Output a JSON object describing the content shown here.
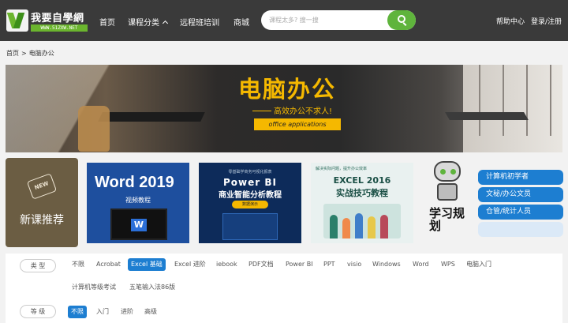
{
  "header": {
    "logo_name": "我要自學網",
    "logo_url": "WWW.51ZXW.NET",
    "nav": [
      "首页",
      "课程分类",
      "远程班培训",
      "商城"
    ],
    "search_placeholder": "课程太多? 搜一搜",
    "help": "帮助中心",
    "login": "登录/注册",
    "colors": {
      "bar": "#3a3a3a",
      "accent": "#5fb43c"
    }
  },
  "breadcrumb": {
    "home": "首页",
    "sep": ">",
    "current": "电脑办公"
  },
  "banner": {
    "title": "电脑办公",
    "subtitle": "高效办公不求人!",
    "tag": "office applications",
    "accent": "#f5b800"
  },
  "new_courses": {
    "badge": "NEW",
    "label": "新课推荐",
    "cards": [
      {
        "title": "Word 2019",
        "subtitle": "视频教程",
        "icon": "word-icon",
        "logo_letter": "W"
      },
      {
        "kicker": "零基础学商务可视化报表",
        "title": "Power BI",
        "subtitle": "商业智能分析教程",
        "pill": "数据演示"
      },
      {
        "kicker": "解决实际问题，提升办公效率",
        "title": "EXCEL 2016",
        "subtitle": "实战技巧教程"
      }
    ]
  },
  "study_plan": {
    "label": "学习规划",
    "buttons": [
      "计算机初学者",
      "文秘/办公文员",
      "仓管/统计人员",
      ""
    ]
  },
  "filters": {
    "type": {
      "label": "类 型",
      "options": [
        "不限",
        "Acrobat",
        "Excel 基础",
        "Excel 进阶",
        "iebook",
        "PDF文档",
        "Power BI",
        "PPT",
        "visio",
        "Windows",
        "Word",
        "WPS",
        "电脑入门",
        "计算机等级考试",
        "五笔输入法86版"
      ],
      "active": "Excel 基础"
    },
    "level": {
      "label": "等 级",
      "options": [
        "不限",
        "入门",
        "进阶",
        "高级"
      ],
      "active": "不限"
    },
    "active_color": "#1d7ed1"
  }
}
